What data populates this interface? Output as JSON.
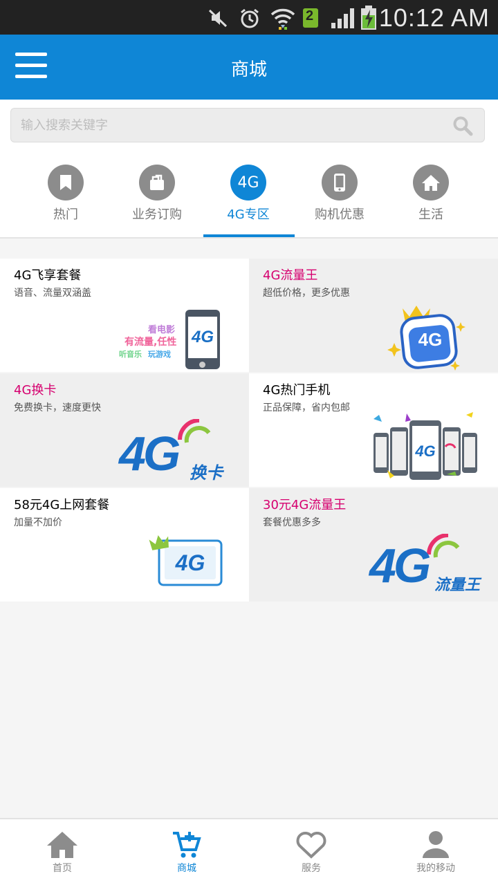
{
  "status_bar": {
    "time": "10:12 AM",
    "sim_badge": "2",
    "icons": [
      "mute-icon",
      "alarm-icon",
      "wifi-icon",
      "sim-icon",
      "signal-icon",
      "battery-charging-icon"
    ]
  },
  "app_bar": {
    "title": "商城",
    "menu_icon": "hamburger-menu-icon"
  },
  "search": {
    "placeholder": "输入搜索关键字",
    "value": "",
    "icon": "search-icon"
  },
  "categories": [
    {
      "label": "热门",
      "icon": "bookmark-icon",
      "active": false
    },
    {
      "label": "业务订购",
      "icon": "bag-icon",
      "active": false
    },
    {
      "label": "4G专区",
      "icon_text": "4G",
      "active": true
    },
    {
      "label": "购机优惠",
      "icon": "phone-icon",
      "active": false
    },
    {
      "label": "生活",
      "icon": "home-icon",
      "active": false
    }
  ],
  "products": [
    {
      "title": "4G飞享套餐",
      "subtitle": "语音、流量双涵盖",
      "title_color": "#222222",
      "art_text": {
        "line1": "看电影",
        "line2": "有流量,任性",
        "line3a": "听音乐",
        "line3b": "玩游戏",
        "badge": "4G"
      }
    },
    {
      "title": "4G流量王",
      "subtitle": "超低价格，更多优惠",
      "title_color": "#d6006f",
      "art_text": {
        "badge": "4G"
      }
    },
    {
      "title": "4G换卡",
      "subtitle": "免费换卡，速度更快",
      "title_color": "#d6006f",
      "art_text": {
        "big": "4G",
        "tag": "换卡"
      }
    },
    {
      "title": "4G热门手机",
      "subtitle": "正品保障，省内包邮",
      "title_color": "#222222",
      "art_text": {
        "badge": "4G"
      }
    },
    {
      "title": "58元4G上网套餐",
      "subtitle": "加量不加价",
      "title_color": "#222222",
      "art_text": {
        "badge": "4G"
      }
    },
    {
      "title": "30元4G流量王",
      "subtitle": "套餐优惠多多",
      "title_color": "#d6006f",
      "art_text": {
        "big": "4G",
        "tag": "流量王"
      }
    }
  ],
  "bottom_nav": [
    {
      "label": "首页",
      "icon": "home-icon",
      "active": false
    },
    {
      "label": "商城",
      "icon": "cart-icon",
      "active": true
    },
    {
      "label": "服务",
      "icon": "heart-icon",
      "active": false
    },
    {
      "label": "我的移动",
      "icon": "user-icon",
      "active": false
    }
  ],
  "colors": {
    "primary": "#0f86d6",
    "accent_pink": "#d6006f",
    "inactive": "#8c8c8c"
  }
}
